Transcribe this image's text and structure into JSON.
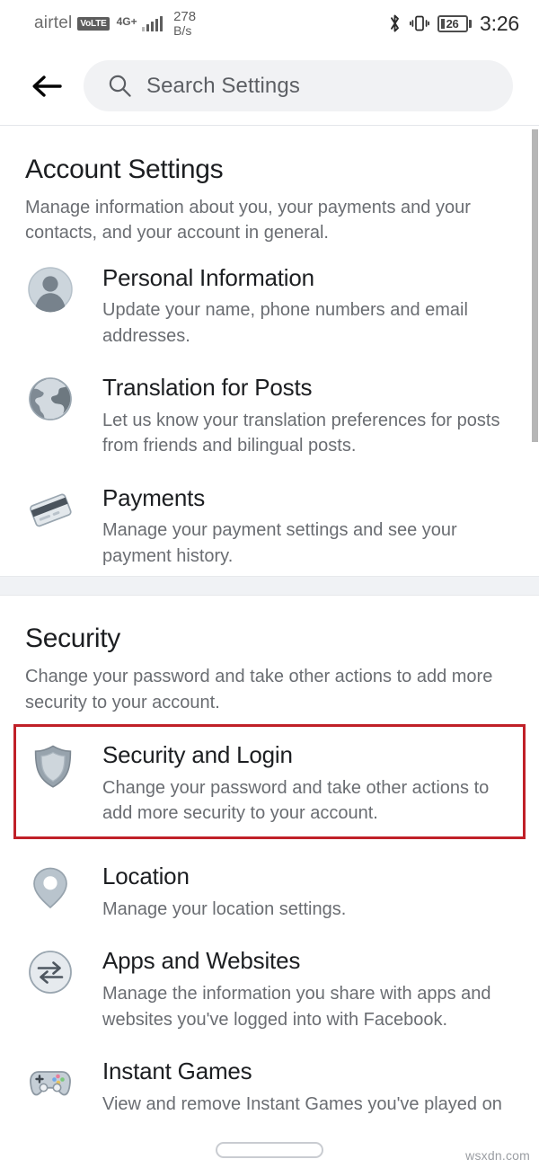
{
  "status_bar": {
    "carrier": "airtel",
    "volte_badge": "VoLTE",
    "network_type": "4G+",
    "net_speed_value": "278",
    "net_speed_unit": "B/s",
    "battery_level": "26",
    "clock": "3:26",
    "icons": [
      "bluetooth-icon",
      "vibrate-icon",
      "battery-icon"
    ]
  },
  "header": {
    "back_label": "back-arrow",
    "search_placeholder": "Search Settings",
    "search_value": ""
  },
  "sections": [
    {
      "title": "Account Settings",
      "description": "Manage information about you, your payments and your contacts, and your account in general.",
      "rows": [
        {
          "icon": "person-circle-icon",
          "title": "Personal Information",
          "description": "Update your name, phone numbers and email addresses.",
          "highlighted": false
        },
        {
          "icon": "globe-icon",
          "title": "Translation for Posts",
          "description": "Let us know your translation preferences for posts from friends and bilingual posts.",
          "highlighted": false
        },
        {
          "icon": "credit-card-icon",
          "title": "Payments",
          "description": "Manage your payment settings and see your payment history.",
          "highlighted": false
        }
      ]
    },
    {
      "title": "Security",
      "description": "Change your password and take other actions to add more security to your account.",
      "rows": [
        {
          "icon": "shield-icon",
          "title": "Security and Login",
          "description": "Change your password and take other actions to add more security to your account.",
          "highlighted": true
        },
        {
          "icon": "location-pin-icon",
          "title": "Location",
          "description": "Manage your location settings.",
          "highlighted": false
        },
        {
          "icon": "exchange-arrows-icon",
          "title": "Apps and Websites",
          "description": "Manage the information you share with apps and websites you've logged into with Facebook.",
          "highlighted": false
        },
        {
          "icon": "game-controller-icon",
          "title": "Instant Games",
          "description": "View and remove Instant Games you've played on Facebook and Messenger.",
          "highlighted": false
        }
      ]
    }
  ],
  "nav": {
    "home_indicator": "home-indicator"
  },
  "watermark": "wsxdn.com",
  "colors": {
    "highlight_border": "#c02028",
    "title_text": "#1c1e21",
    "body_text": "#6a6d72",
    "search_pill_bg": "#f1f2f4",
    "divider_band": "#f0f2f5"
  }
}
